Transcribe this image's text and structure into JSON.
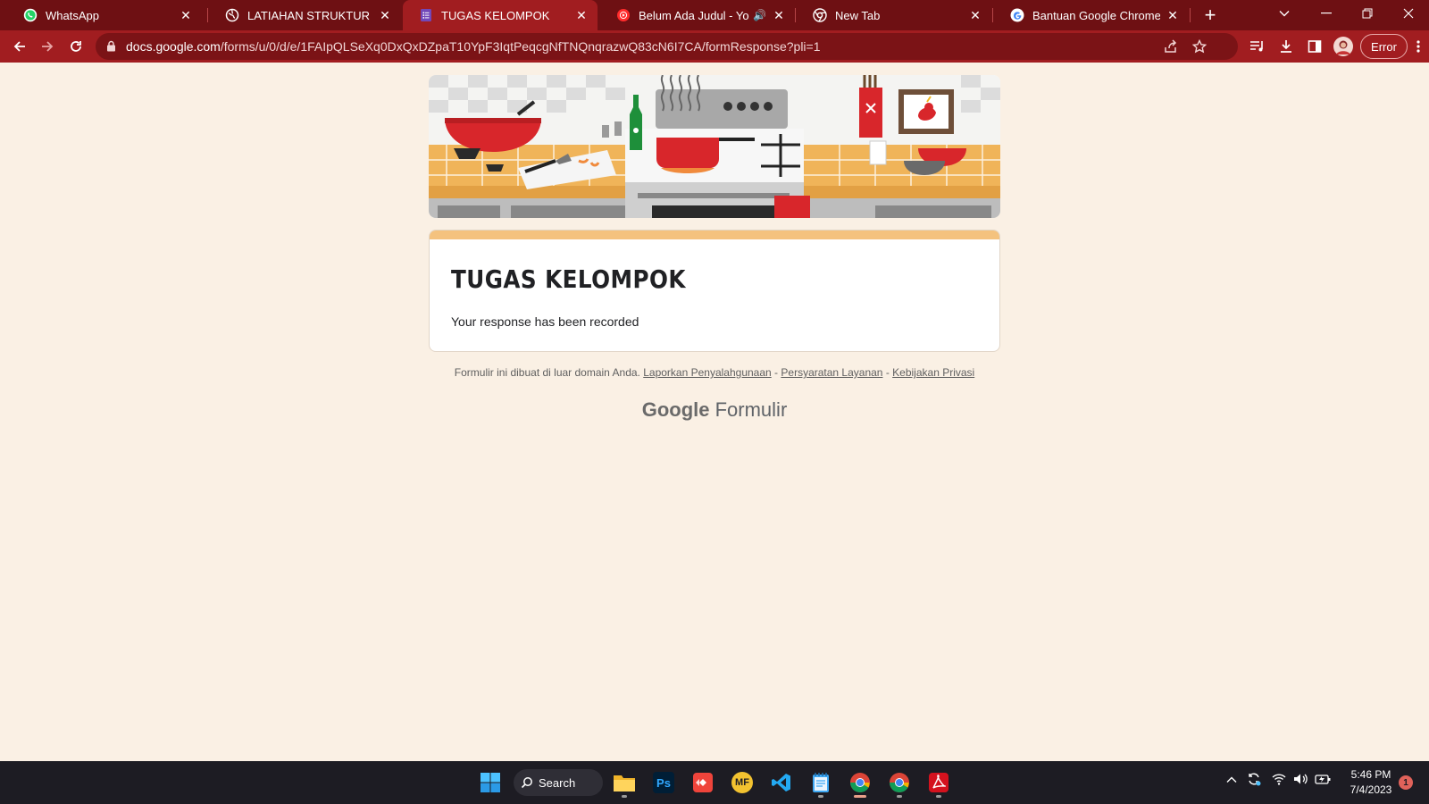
{
  "browser": {
    "tabs": [
      {
        "title": "WhatsApp",
        "icon": "whatsapp-icon"
      },
      {
        "title": "LATIAHAN STRUKTUR DATA.p",
        "icon": "globe-icon"
      },
      {
        "title": "TUGAS KELOMPOK",
        "icon": "google-forms-icon",
        "active": true
      },
      {
        "title": "Belum Ada Judul - YouTu",
        "icon": "youtube-icon",
        "audio": true
      },
      {
        "title": "New Tab",
        "icon": "chrome-icon"
      },
      {
        "title": "Bantuan Google Chrome",
        "icon": "google-icon"
      }
    ],
    "url_host": "docs.google.com",
    "url_path": "/forms/u/0/d/e/1FAIpQLSeXq0DxQxDZpaT10YpF3IqtPeqcgNfTNQnqrazwQ83cN6I7CA/formResponse?pli=1",
    "profile_status": "Error",
    "theme_colors": {
      "tabstrip": "#6e1013",
      "toolbar": "#a11d20"
    }
  },
  "form": {
    "title": "TUGAS KELOMPOK",
    "message": "Your response has been recorded",
    "footer_text": "Formulir ini dibuat di luar domain Anda.",
    "footer_links": [
      "Laporkan Penyalahgunaan",
      "Persyaratan Layanan",
      "Kebijakan Privasi"
    ],
    "separator": "-",
    "brand_google": "Google",
    "brand_product": "Formulir",
    "accent_color": "#f4c27e",
    "background_color": "#faf0e4"
  },
  "taskbar": {
    "search_label": "Search",
    "apps": [
      "file-explorer-icon",
      "photoshop-icon",
      "anydesk-icon",
      "mf-app-icon",
      "vscode-icon",
      "notepad-icon",
      "chrome-icon",
      "chrome-icon",
      "acrobat-icon"
    ],
    "photoshop_label": "Ps",
    "mf_label": "MF",
    "time": "5:46 PM",
    "date": "7/4/2023",
    "notification_count": "1"
  }
}
